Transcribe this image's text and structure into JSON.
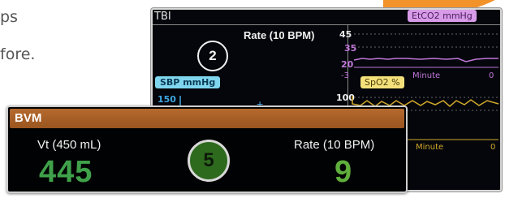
{
  "background_text": [
    "ps",
    "fore."
  ],
  "back_monitor": {
    "title": "TBI",
    "rate_label": "Rate (10 BPM)",
    "counter": "2",
    "etco2_tag": "EtCO2 mmHg",
    "etco2_ticks": [
      "45",
      "35",
      "20"
    ],
    "etco2_axis": {
      "start": "-3",
      "label": "Minute",
      "end": "0"
    },
    "sbp_tag": "SBP mmHg",
    "sbp_tick": "150",
    "spo2_tag": "SpO2 %",
    "spo2_tick": "100",
    "spo2_axis": {
      "label": "Minute",
      "end": "0"
    },
    "colors": {
      "etco2": "#c177d9",
      "sbp": "#3ea6e0",
      "spo2": "#d2a92a"
    }
  },
  "bvm_panel": {
    "title": "BVM",
    "vt_label": "Vt (450 mL)",
    "vt_value": "445",
    "rate_label": "Rate (10 BPM)",
    "rate_value": "9",
    "counter": "5",
    "colors": {
      "header": "#a85e25",
      "values": "#3fa14a"
    }
  }
}
